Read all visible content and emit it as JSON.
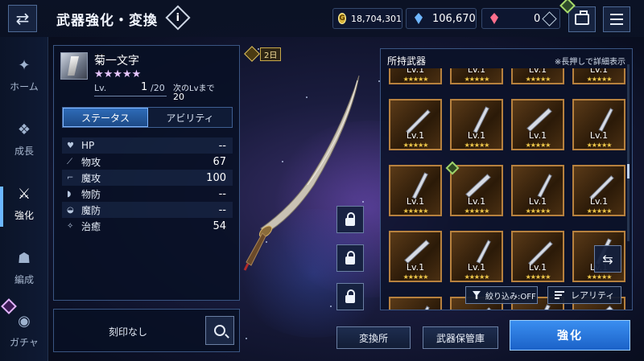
{
  "header": {
    "title": "武器強化・変換",
    "info_label": "i",
    "currency": {
      "gold": "18,704,301",
      "gold_symbol": "G",
      "crystal": "106,670",
      "red_gem": "0"
    }
  },
  "nav": [
    {
      "label": "ホーム",
      "icon": "home-icon",
      "active": false
    },
    {
      "label": "成長",
      "icon": "growth-icon",
      "active": false
    },
    {
      "label": "強化",
      "icon": "enhance-sword-icon",
      "active": true
    },
    {
      "label": "編成",
      "icon": "party-icon",
      "active": false
    },
    {
      "label": "ガチャ",
      "icon": "gacha-icon",
      "active": false
    }
  ],
  "weapon": {
    "name": "菊一文字",
    "stars": "★★★★★",
    "lv_label": "Lv.",
    "lv_value": "1",
    "lv_max": "/20",
    "next_label": "次のLvまで",
    "next_value": "20",
    "timer": "2日"
  },
  "tabs": {
    "status": "ステータス",
    "ability": "アビリティ"
  },
  "stats": [
    {
      "icon": "♥",
      "name": "HP",
      "value": "--"
    },
    {
      "icon": "⟋",
      "name": "物攻",
      "value": "67"
    },
    {
      "icon": "⌐",
      "name": "魔攻",
      "value": "100"
    },
    {
      "icon": "◗",
      "name": "物防",
      "value": "--"
    },
    {
      "icon": "◒",
      "name": "魔防",
      "value": "--"
    },
    {
      "icon": "✧",
      "name": "治癒",
      "value": "54"
    }
  ],
  "engrave": {
    "text": "刻印なし"
  },
  "inventory": {
    "title": "所持武器",
    "hint": "※長押しで詳細表示",
    "item_level": "Lv.1",
    "item_stars": "★★★★★",
    "filter_label": "絞り込み:OFF",
    "rarity_label": "レアリティ",
    "swap_icon": "⇆"
  },
  "buttons": {
    "exchange": "変換所",
    "storage": "武器保管庫",
    "enhance": "強化"
  }
}
